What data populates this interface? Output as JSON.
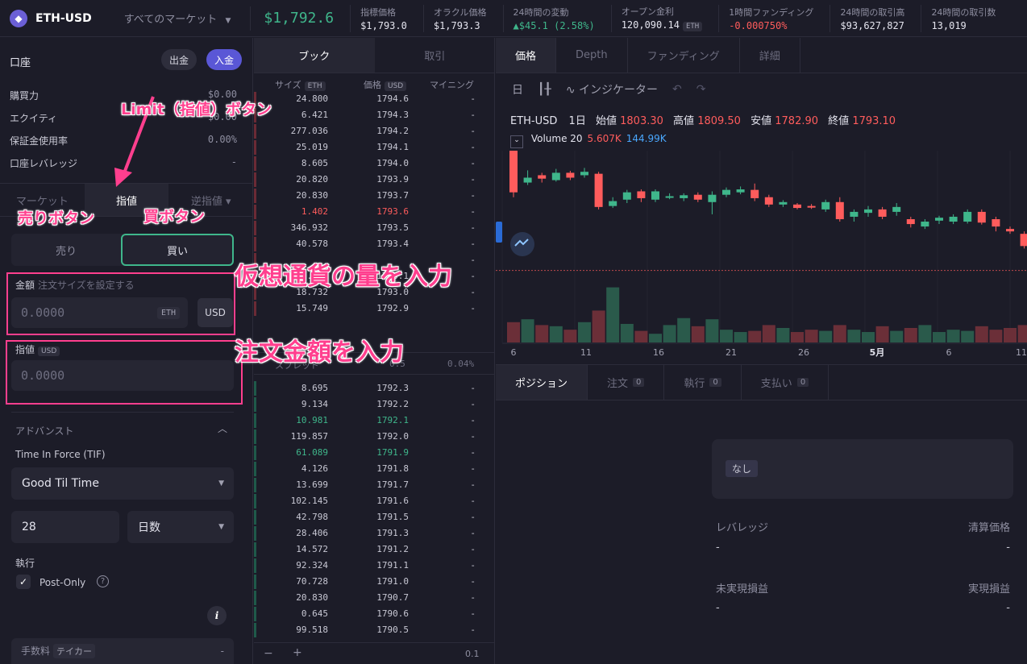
{
  "header": {
    "logo_glyph": "◆",
    "market": "ETH-USD",
    "all_markets": "すべてのマーケット",
    "price": "$1,792.6",
    "stats": [
      {
        "label": "指標価格",
        "value": "$1,793.0",
        "tone": ""
      },
      {
        "label": "オラクル価格",
        "value": "$1,793.3",
        "tone": ""
      },
      {
        "label": "24時間の変動",
        "value": "▲$45.1 (2.58%)",
        "tone": "green"
      },
      {
        "label": "オープン金利",
        "value": "120,090.14",
        "tag": "ETH",
        "tone": ""
      },
      {
        "label": "1時間ファンディング",
        "value": "-0.000750%",
        "tone": "red"
      },
      {
        "label": "24時間の取引高",
        "value": "$93,627,827",
        "tone": ""
      },
      {
        "label": "24時間の取引数",
        "value": "13,019",
        "tone": ""
      }
    ]
  },
  "account": {
    "title": "口座",
    "withdraw": "出金",
    "deposit": "入金",
    "rows": [
      {
        "label": "購買力",
        "value": "$0.00"
      },
      {
        "label": "エクイティ",
        "value": "$0.00"
      },
      {
        "label": "保証金使用率",
        "value": "0.00%"
      },
      {
        "label": "口座レバレッジ",
        "value": "-"
      }
    ]
  },
  "order_form": {
    "tabs": [
      "マーケット",
      "指値",
      "逆指値 ▾"
    ],
    "sell": "売り",
    "buy": "買い",
    "amount_label": "金額",
    "amount_hint": "注文サイズを設定する",
    "amount_value": "0.0000",
    "amount_unit": "ETH",
    "usd_button": "USD",
    "limit_label": "指値",
    "limit_unit": "USD",
    "limit_value": "0.0000",
    "advanced": "アドバンスト",
    "tif_label": "Time In Force (TIF)",
    "tif_value": "Good Til Time",
    "duration_value": "28",
    "duration_unit": "日数",
    "exec_label": "執行",
    "post_only": "Post-Only",
    "fee_label": "手数料",
    "fee_tag": "テイカー",
    "fee_value": "-"
  },
  "annotations": {
    "limit_btn": "Limit（指値）ボタン",
    "sell_btn": "売りボタン",
    "buy_btn": "買ボタン",
    "amount": "仮想通貨の量を入力",
    "price": "注文金額を入力"
  },
  "orderbook": {
    "tabs": [
      "ブック",
      "取引"
    ],
    "head_size": "サイズ",
    "head_size_tag": "ETH",
    "head_price": "価格",
    "head_price_tag": "USD",
    "head_mining": "マイニング",
    "asks": [
      {
        "size": "24.800",
        "price": "1794.6",
        "hl": ""
      },
      {
        "size": "6.421",
        "price": "1794.3",
        "hl": ""
      },
      {
        "size": "277.036",
        "price": "1794.2",
        "hl": ""
      },
      {
        "size": "25.019",
        "price": "1794.1",
        "hl": ""
      },
      {
        "size": "8.605",
        "price": "1794.0",
        "hl": ""
      },
      {
        "size": "20.820",
        "price": "1793.9",
        "hl": ""
      },
      {
        "size": "20.830",
        "price": "1793.7",
        "hl": ""
      },
      {
        "size": "1.402",
        "price": "1793.6",
        "hl": "red"
      },
      {
        "size": "346.932",
        "price": "1793.5",
        "hl": ""
      },
      {
        "size": "40.578",
        "price": "1793.4",
        "hl": ""
      },
      {
        "size": "",
        "price": "",
        "hl": ""
      },
      {
        "size": "93.530",
        "price": "1793.1",
        "hl": ""
      },
      {
        "size": "18.732",
        "price": "1793.0",
        "hl": ""
      },
      {
        "size": "15.749",
        "price": "1792.9",
        "hl": ""
      }
    ],
    "spread_label": "スプレッド",
    "spread_value": "0.5",
    "spread_pct": "0.04%",
    "bids": [
      {
        "size": "8.695",
        "price": "1792.3",
        "hl": ""
      },
      {
        "size": "9.134",
        "price": "1792.2",
        "hl": ""
      },
      {
        "size": "10.981",
        "price": "1792.1",
        "hl": "green"
      },
      {
        "size": "119.857",
        "price": "1792.0",
        "hl": ""
      },
      {
        "size": "61.089",
        "price": "1791.9",
        "hl": "green"
      },
      {
        "size": "4.126",
        "price": "1791.8",
        "hl": ""
      },
      {
        "size": "13.699",
        "price": "1791.7",
        "hl": ""
      },
      {
        "size": "102.145",
        "price": "1791.6",
        "hl": ""
      },
      {
        "size": "42.798",
        "price": "1791.5",
        "hl": ""
      },
      {
        "size": "28.406",
        "price": "1791.3",
        "hl": ""
      },
      {
        "size": "14.572",
        "price": "1791.2",
        "hl": ""
      },
      {
        "size": "92.324",
        "price": "1791.1",
        "hl": ""
      },
      {
        "size": "70.728",
        "price": "1791.0",
        "hl": ""
      },
      {
        "size": "20.830",
        "price": "1790.7",
        "hl": ""
      },
      {
        "size": "0.645",
        "price": "1790.6",
        "hl": ""
      },
      {
        "size": "99.518",
        "price": "1790.5",
        "hl": ""
      }
    ],
    "mining_dash": "-",
    "foot_minus": "−",
    "foot_plus": "+",
    "foot_group": "0.1"
  },
  "chart_panel": {
    "tabs": [
      "価格",
      "Depth",
      "ファンディング",
      "詳細"
    ],
    "toolbar_day": "日",
    "toolbar_indicator": "インジケーター",
    "symbol": "ETH-USD",
    "interval": "1日",
    "open_label": "始値",
    "open": "1803.30",
    "high_label": "高値",
    "high": "1809.50",
    "low_label": "安値",
    "low": "1782.90",
    "close_label": "終値",
    "close": "1793.10",
    "volume_label": "Volume 20",
    "vol_a": "5.607K",
    "vol_b": "144.99K",
    "up_color": "#3fb68b",
    "down_color": "#ff5c5c"
  },
  "chart_data": {
    "type": "candlestick",
    "x_ticks": [
      "6",
      "11",
      "16",
      "21",
      "26",
      "5月",
      "6",
      "11"
    ],
    "candles": [
      {
        "o": 1,
        "c": 0,
        "h": 1.05,
        "l": -0.1
      },
      {
        "o": 0.2,
        "c": 0.3,
        "h": 0.45,
        "l": 0.15
      },
      {
        "o": 0.35,
        "c": 0.28,
        "h": 0.4,
        "l": 0.2
      },
      {
        "o": 0.25,
        "c": 0.4,
        "h": 0.48,
        "l": 0.22
      },
      {
        "o": 0.4,
        "c": 0.3,
        "h": 0.44,
        "l": 0.25
      },
      {
        "o": 0.35,
        "c": 0.42,
        "h": 0.5,
        "l": 0.3
      },
      {
        "o": 0.38,
        "c": -0.3,
        "h": 0.42,
        "l": -0.35
      },
      {
        "o": -0.28,
        "c": -0.18,
        "h": -0.1,
        "l": -0.32
      },
      {
        "o": -0.15,
        "c": 0.0,
        "h": 0.05,
        "l": -0.22
      },
      {
        "o": 0.02,
        "c": -0.12,
        "h": 0.06,
        "l": -0.2
      },
      {
        "o": -0.15,
        "c": 0.02,
        "h": 0.06,
        "l": -0.2
      },
      {
        "o": -0.1,
        "c": -0.08,
        "h": -0.02,
        "l": -0.14
      },
      {
        "o": -0.12,
        "c": -0.06,
        "h": -0.02,
        "l": -0.18
      },
      {
        "o": -0.05,
        "c": -0.15,
        "h": 0.0,
        "l": -0.2
      },
      {
        "o": -0.2,
        "c": -0.05,
        "h": 0.02,
        "l": -0.45
      },
      {
        "o": -0.05,
        "c": 0.05,
        "h": 0.1,
        "l": -0.1
      },
      {
        "o": 0.0,
        "c": 0.06,
        "h": 0.12,
        "l": -0.04
      },
      {
        "o": 0.05,
        "c": -0.12,
        "h": 0.18,
        "l": -0.18
      },
      {
        "o": -0.1,
        "c": -0.25,
        "h": -0.05,
        "l": -0.3
      },
      {
        "o": -0.25,
        "c": -0.2,
        "h": -0.16,
        "l": -0.3
      },
      {
        "o": -0.25,
        "c": -0.32,
        "h": -0.22,
        "l": -0.35
      },
      {
        "o": -0.28,
        "c": -0.3,
        "h": -0.24,
        "l": -0.34
      },
      {
        "o": -0.35,
        "c": -0.2,
        "h": -0.15,
        "l": -0.4
      },
      {
        "o": -0.2,
        "c": -0.55,
        "h": -0.1,
        "l": -0.6
      },
      {
        "o": -0.5,
        "c": -0.4,
        "h": -0.35,
        "l": -0.6
      },
      {
        "o": -0.42,
        "c": -0.35,
        "h": -0.28,
        "l": -0.5
      },
      {
        "o": -0.35,
        "c": -0.5,
        "h": -0.3,
        "l": -0.55
      },
      {
        "o": -0.4,
        "c": -0.3,
        "h": -0.22,
        "l": -0.48
      },
      {
        "o": -0.55,
        "c": -0.65,
        "h": -0.5,
        "l": -0.72
      },
      {
        "o": -0.7,
        "c": -0.6,
        "h": -0.55,
        "l": -0.75
      },
      {
        "o": -0.58,
        "c": -0.52,
        "h": -0.48,
        "l": -0.65
      },
      {
        "o": -0.6,
        "c": -0.5,
        "h": -0.45,
        "l": -0.65
      },
      {
        "o": -0.6,
        "c": -0.4,
        "h": -0.35,
        "l": -0.64
      },
      {
        "o": -0.4,
        "c": -0.62,
        "h": -0.35,
        "l": -0.66
      },
      {
        "o": -0.55,
        "c": -0.7,
        "h": -0.5,
        "l": -0.8
      },
      {
        "o": -0.75,
        "c": -0.8,
        "h": -0.7,
        "l": -0.85
      },
      {
        "o": -0.85,
        "c": -1.1,
        "h": -0.8,
        "l": -1.15
      },
      {
        "o": -1.2,
        "c": -1.7,
        "h": -1.15,
        "l": -1.75
      },
      {
        "o": -1.8,
        "c": -1.6,
        "h": -1.5,
        "l": -1.85
      },
      {
        "o": -1.6,
        "c": -2.0,
        "h": -1.55,
        "l": -2.1
      }
    ],
    "volumes": [
      0.35,
      0.4,
      0.3,
      0.28,
      0.22,
      0.35,
      0.55,
      0.95,
      0.32,
      0.2,
      0.15,
      0.3,
      0.42,
      0.28,
      0.4,
      0.22,
      0.18,
      0.2,
      0.3,
      0.25,
      0.18,
      0.22,
      0.2,
      0.3,
      0.22,
      0.18,
      0.28,
      0.2,
      0.25,
      0.3,
      0.18,
      0.22,
      0.2,
      0.28,
      0.22,
      0.25,
      0.3,
      0.7,
      0.5,
      0.9
    ]
  },
  "positions": {
    "tabs": [
      {
        "label": "ポジション",
        "count": ""
      },
      {
        "label": "注文",
        "count": "0"
      },
      {
        "label": "執行",
        "count": "0"
      },
      {
        "label": "支払い",
        "count": "0"
      }
    ],
    "none": "なし",
    "leverage": "レバレッジ",
    "liq_price": "清算価格",
    "unrealized": "未実現損益",
    "realized": "実現損益",
    "dash": "-"
  }
}
